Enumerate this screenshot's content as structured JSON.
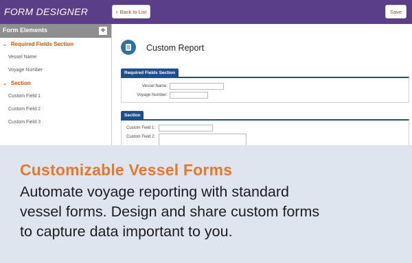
{
  "app": {
    "title": "FORM DESIGNER"
  },
  "toolbar": {
    "back_label": "Back to List",
    "save_label": "Save"
  },
  "sidebar": {
    "header": "Form Elements",
    "sections": [
      {
        "label": "Required Fields Section",
        "fields": [
          "Vessel Name",
          "Voyage Number"
        ]
      },
      {
        "label": "Section",
        "fields": [
          "Custom Field 1",
          "Custom Field 2",
          "Custom Field 3"
        ]
      }
    ]
  },
  "report": {
    "title": "Custom Report",
    "panels": [
      {
        "tab": "Required Fields Section",
        "fields": [
          "Vessel Name:",
          "Voyage Number:"
        ]
      },
      {
        "tab": "Section",
        "fields": [
          "Custom Field 1:",
          "Custom Field 2:"
        ]
      }
    ]
  },
  "promo": {
    "title": "Customizable Vessel Forms",
    "lines": [
      "Automate voyage reporting with standard",
      "vessel forms. Design and share custom forms",
      "to capture data important to you."
    ]
  },
  "colors": {
    "topbar": "#5a3e87",
    "accent_orange": "#e8772e",
    "panel_blue": "#1f4e8c",
    "promo_bg": "#dfe5ef"
  },
  "icons": [
    "chevron-left-icon",
    "plus-icon",
    "chevron-down-icon",
    "document-list-icon"
  ]
}
